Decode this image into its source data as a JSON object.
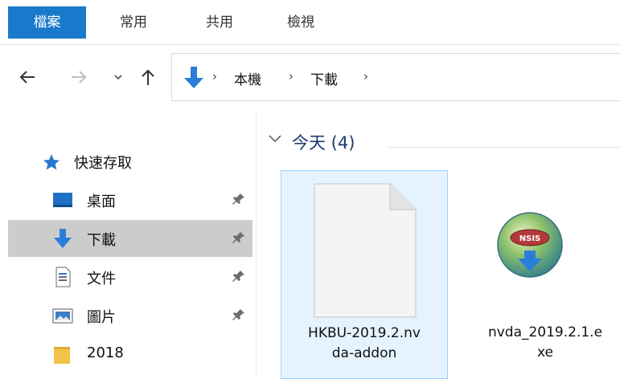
{
  "ribbon": {
    "tabs": [
      {
        "label": "檔案",
        "active": true
      },
      {
        "label": "常用",
        "active": false
      },
      {
        "label": "共用",
        "active": false
      },
      {
        "label": "檢視",
        "active": false
      }
    ]
  },
  "nav": {
    "back_icon": "arrow-left-icon",
    "forward_icon": "arrow-right-icon",
    "recent_icon": "chevron-down-icon",
    "up_icon": "arrow-up-icon"
  },
  "address": {
    "icon": "downloads-icon",
    "crumbs": [
      "本機",
      "下載"
    ],
    "separator": "›"
  },
  "sidebar": {
    "quick_access": "快速存取",
    "items": [
      {
        "label": "桌面",
        "icon": "desktop-icon",
        "pinned": true,
        "selected": false
      },
      {
        "label": "下載",
        "icon": "download-arrow-icon",
        "pinned": true,
        "selected": true
      },
      {
        "label": "文件",
        "icon": "document-icon",
        "pinned": true,
        "selected": false
      },
      {
        "label": "圖片",
        "icon": "picture-icon",
        "pinned": true,
        "selected": false
      },
      {
        "label": "2018",
        "icon": "folder-icon",
        "pinned": false,
        "selected": false
      }
    ]
  },
  "content": {
    "group": {
      "label": "今天 (4)",
      "chevron": "chevron-down-icon"
    },
    "files": [
      {
        "name_line1": "HKBU-2019.2.nv",
        "name_line2": "da-addon",
        "icon": "blank-file-icon",
        "selected": true
      },
      {
        "name_line1": "nvda_2019.2.1.e",
        "name_line2": "xe",
        "icon": "nsis-installer-icon",
        "selected": false
      }
    ]
  },
  "colors": {
    "accent": "#1979ca",
    "selection": "#cccccc",
    "file_selection": "#e5f3ff",
    "group_label": "#1e3a6e"
  }
}
